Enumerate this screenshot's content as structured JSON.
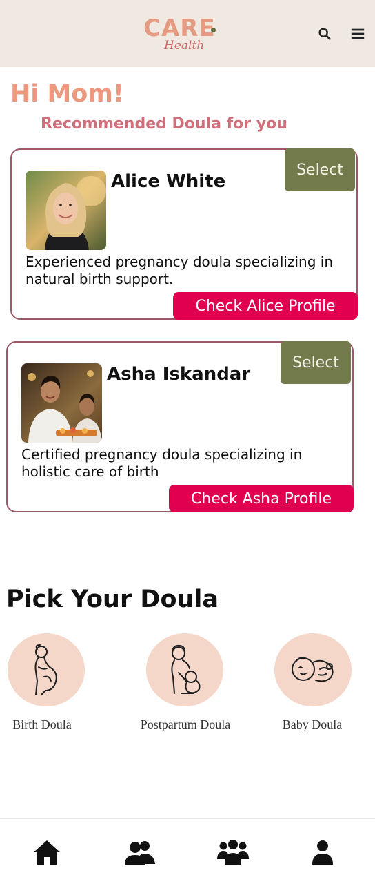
{
  "header": {
    "logo_primary": "CARE",
    "logo_secondary": "Health",
    "search_icon": "search-icon",
    "menu_icon": "hamburger-menu-icon"
  },
  "greeting": "Hi Mom!",
  "subtitle": "Recommended Doula for you",
  "cards": [
    {
      "name": "Alice White",
      "description": "Experienced pregnancy doula specializing in natural birth support.",
      "select_label": "Select",
      "profile_label": "Check Alice Profile"
    },
    {
      "name": "Asha Iskandar",
      "description": "Certified pregnancy doula specializing in holistic care of birth",
      "select_label": "Select",
      "profile_label": "Check Asha Profile"
    }
  ],
  "pick_section": {
    "title": "Pick Your Doula",
    "types": [
      {
        "label": "Birth Doula",
        "icon": "pregnant-woman-icon"
      },
      {
        "label": "Postpartum Doula",
        "icon": "mother-baby-icon"
      },
      {
        "label": "Baby Doula",
        "icon": "newborn-baby-icon"
      }
    ]
  },
  "bottom_nav": [
    {
      "icon": "home-icon"
    },
    {
      "icon": "two-users-icon"
    },
    {
      "icon": "group-icon"
    },
    {
      "icon": "profile-icon"
    }
  ],
  "colors": {
    "header_bg": "#efe9e1",
    "accent_salmon": "#ee9880",
    "select_olive": "#737a4c",
    "profile_pink": "#e0004f",
    "card_border": "#9c5a68",
    "doula_circle": "#f4d7c9"
  }
}
